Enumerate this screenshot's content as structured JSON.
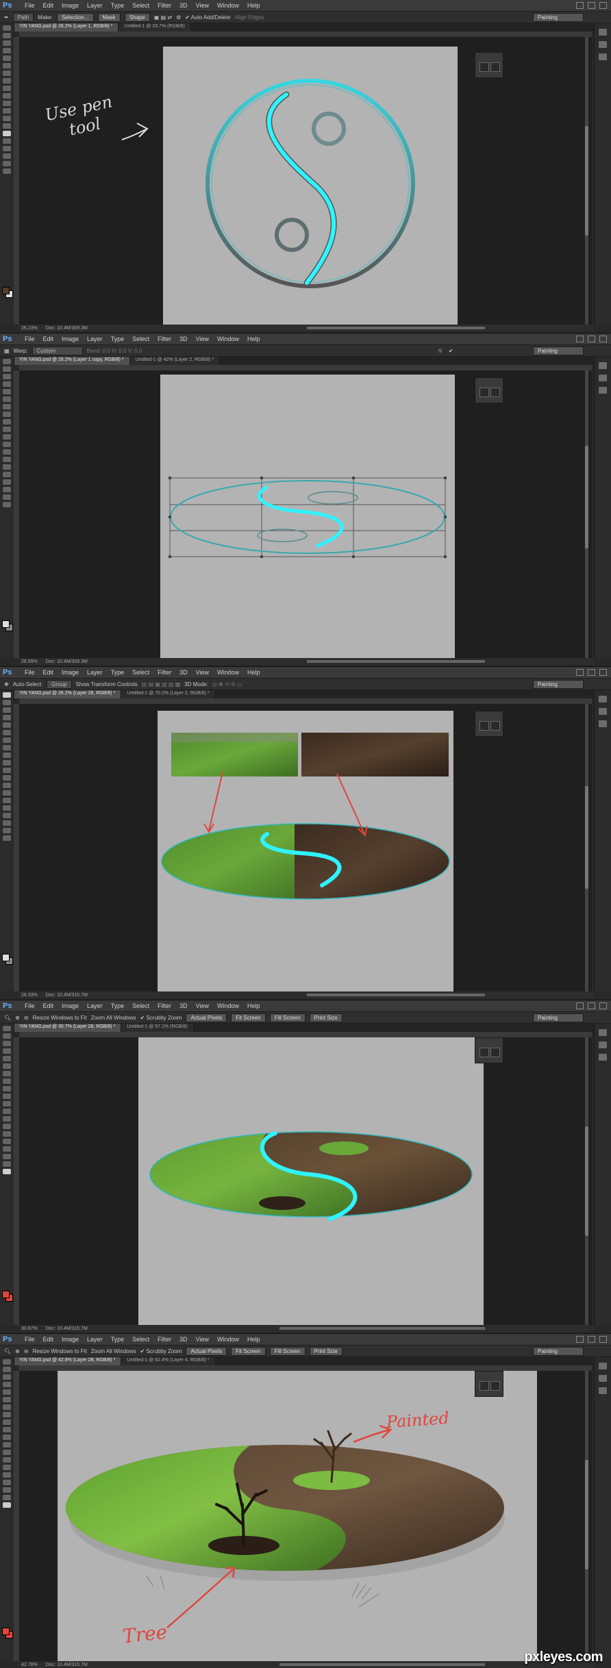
{
  "app": {
    "logo": "Ps",
    "menu": [
      "File",
      "Edit",
      "Image",
      "Layer",
      "Type",
      "Select",
      "Filter",
      "3D",
      "View",
      "Window",
      "Help"
    ],
    "workspace": "Painting"
  },
  "panels": [
    {
      "options": [
        "Path",
        "Make:",
        "Selection...",
        "Mask",
        "Shape"
      ],
      "option_check": "Auto Add/Delete",
      "option_extra": "Align Edges",
      "tabs": [
        {
          "label": "YIN YANG.psd @ 26.2% (Layer 1, RGB/8) *",
          "active": true
        },
        {
          "label": "Untitled-1 @ 23.7% (RGB/8)",
          "active": false
        }
      ],
      "zoom": "26.23%",
      "doc": "Doc: 10.4M/309.3M",
      "annotation": [
        "Use pen",
        "tool"
      ]
    },
    {
      "options": [
        "Warp:",
        "Custom"
      ],
      "option_extra": "Bend: 0.0    H: 0.0    V: 0.0",
      "tabs": [
        {
          "label": "YIN YANG.psd @ 26.2% (Layer 1 copy, RGB/8) *",
          "active": true
        },
        {
          "label": "Untitled-1 @ 42% (Layer 2, RGB/8) *",
          "active": false
        }
      ],
      "zoom": "26.59%",
      "doc": "Doc: 10.4M/309.3M"
    },
    {
      "options": [
        "Auto-Select:",
        "Group"
      ],
      "option_check": "Show Transform Controls",
      "option_extra": "3D Mode:",
      "tabs": [
        {
          "label": "YIN YANG.psd @ 26.2% (Layer 28, RGB/8) *",
          "active": true
        },
        {
          "label": "Untitled-1 @ 70.2% (Layer 2, RGB/8) *",
          "active": false
        }
      ],
      "zoom": "26.33%",
      "doc": "Doc: 10.4M/315.7M"
    },
    {
      "options": [
        "Resize Windows to Fit",
        "Zoom All Windows",
        "Scrubby Zoom"
      ],
      "buttons": [
        "Actual Pixels",
        "Fit Screen",
        "Fill Screen",
        "Print Size"
      ],
      "tabs": [
        {
          "label": "YIN YANG.psd @ 30.7% (Layer 28, RGB/8) *",
          "active": true
        },
        {
          "label": "Untitled-1 @ 57.1% (RGB/8)",
          "active": false
        }
      ],
      "zoom": "30.67%",
      "doc": "Doc: 10.4M/315.7M"
    },
    {
      "options": [
        "Resize Windows to Fit",
        "Zoom All Windows",
        "Scrubby Zoom"
      ],
      "buttons": [
        "Actual Pixels",
        "Fit Screen",
        "Fill Screen",
        "Print Size"
      ],
      "tabs": [
        {
          "label": "YIN YANG.psd @ 42.8% (Layer 28, RGB/8) *",
          "active": true
        },
        {
          "label": "Untitled-1 @ 62.4% (Layer 4, RGB/8) *",
          "active": false
        }
      ],
      "zoom": "42.78%",
      "doc": "Doc: 10.4M/315.7M",
      "annotations": [
        "Painted",
        "Tree"
      ]
    }
  ],
  "watermark": "pxleyes.com",
  "colors": {
    "accent": "#35e5ee",
    "annotation_red": "#e0453c",
    "canvas": "#b3b3b3",
    "chrome": "#3a3a3a"
  }
}
